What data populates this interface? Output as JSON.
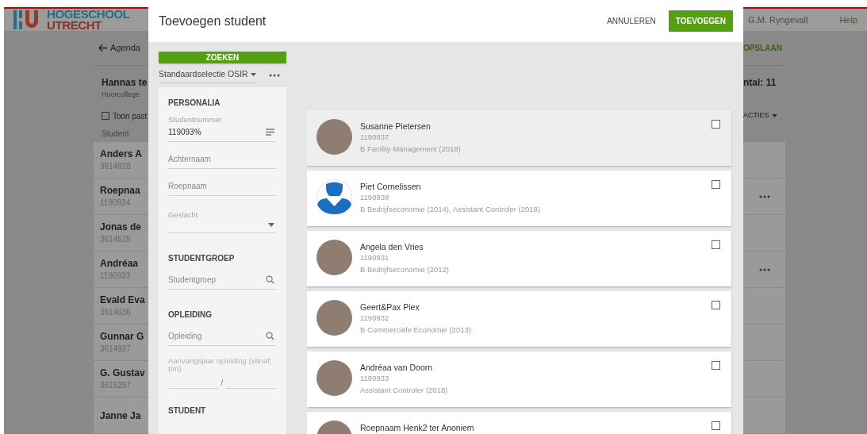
{
  "background": {
    "logo": {
      "line_1": "HOGESCHOOL",
      "line_2": "UTRECHT"
    },
    "user": "G.M. Ryngevall",
    "help": "Help",
    "back_link": "Agenda",
    "save": "OPSLAAN",
    "title": "Hannas te",
    "subtitle": "Hoorcollege",
    "count": "ntal: 11",
    "toggle": {
      "label": "Toon past",
      "checked": false
    },
    "actions": "ACTIES",
    "column": "Student",
    "rows": [
      {
        "name": "Anders A",
        "number": "3614928",
        "menu": false
      },
      {
        "name": "Roepnaa",
        "number": "1190934",
        "menu": true
      },
      {
        "name": "Jonas de",
        "number": "3614525",
        "menu": false
      },
      {
        "name": "Andréaa",
        "number": "1190933",
        "menu": true
      },
      {
        "name": "Evald Eva",
        "number": "3614936",
        "menu": false
      },
      {
        "name": "Gunnar G",
        "number": "3614927",
        "menu": false
      },
      {
        "name": "G. Gustav",
        "number": "3616297",
        "menu": false
      },
      {
        "name": "Janne Ja",
        "menu": false
      }
    ]
  },
  "dialog": {
    "title": "Toevoegen student",
    "cancel": "ANNULEREN",
    "confirm": "TOEVOEGEN",
    "search_button": "ZOEKEN",
    "selection": "Standaardselectie OSIR",
    "filters": {
      "sections": [
        {
          "heading": "PERSONALIA",
          "fields": [
            {
              "kind": "list",
              "label": "Studentnummer",
              "value": "119093%"
            },
            {
              "kind": "text",
              "placeholder": "Achternaam"
            },
            {
              "kind": "text",
              "placeholder": "Roepnaam"
            },
            {
              "kind": "select",
              "label": "Geslacht"
            }
          ]
        },
        {
          "heading": "STUDENTGROEP",
          "fields": [
            {
              "kind": "search",
              "placeholder": "Studentgroep"
            }
          ]
        },
        {
          "heading": "OPLEIDING",
          "fields": [
            {
              "kind": "search",
              "placeholder": "Opleiding"
            },
            {
              "kind": "range",
              "label": "Aanvangsjaar opleiding (vanaf; t/m)",
              "separator": "/"
            }
          ]
        },
        {
          "heading": "STUDENT"
        }
      ]
    },
    "results": [
      {
        "name": "Susanne Pietersen",
        "number": "1190937",
        "programme": "B Facility Management (2018)",
        "kind": "photo",
        "highlighted": true,
        "checked": false
      },
      {
        "name": "Piet Cornelissen",
        "number": "1190938",
        "programme": "B Bedrijfseconomie (2014), Assistant Controler (2018)",
        "kind": "silhouette",
        "highlighted": false,
        "checked": false
      },
      {
        "name": "Angela den Vries",
        "number": "1190931",
        "programme": "B Bedrijfseconomie (2012)",
        "kind": "photo",
        "highlighted": false,
        "checked": false
      },
      {
        "name": "Geert&Pax Piex",
        "number": "1190932",
        "programme": "B Commerciële Economie (2013)",
        "kind": "photo",
        "highlighted": false,
        "checked": false
      },
      {
        "name": "Andréaa van Doorn",
        "number": "1190933",
        "programme": "Assistant Controler (2018)",
        "kind": "photo",
        "highlighted": false,
        "checked": false
      },
      {
        "name": "Roepnaam Henk2 ter Anoniem",
        "kind": "photo",
        "highlighted": false,
        "checked": false
      }
    ]
  }
}
